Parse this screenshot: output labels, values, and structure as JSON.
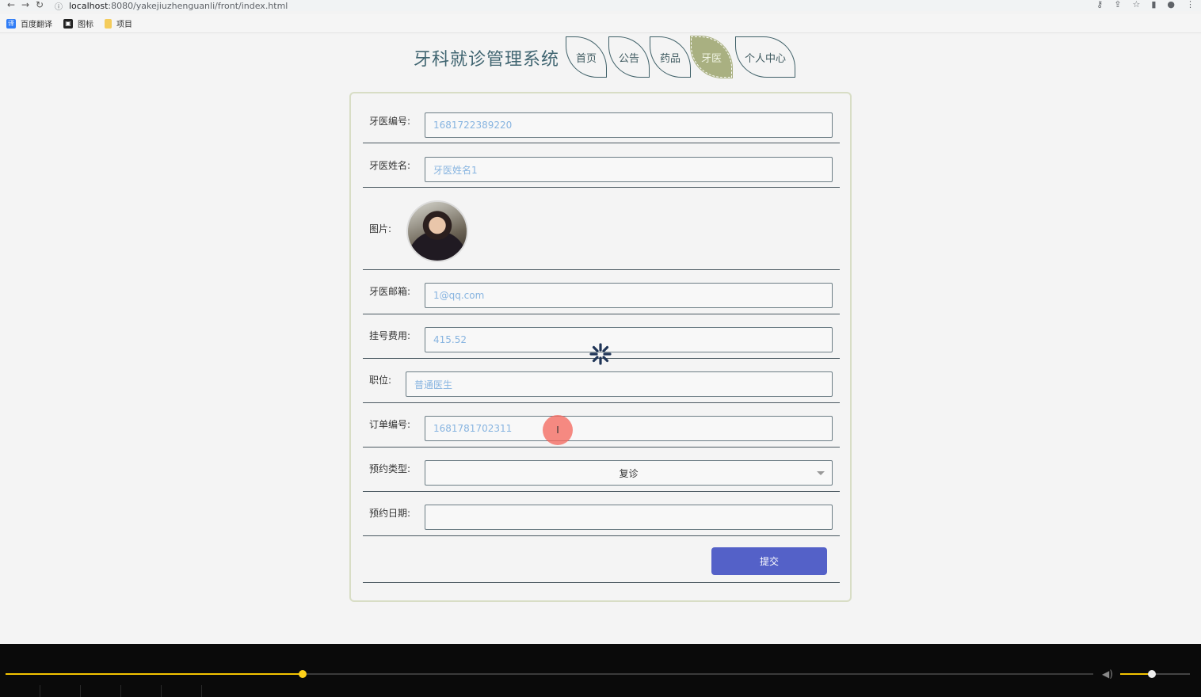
{
  "browser": {
    "url_host": "localhost",
    "url_path": ":8080/yakejiuzhenguanli/front/index.html",
    "bookmarks": [
      {
        "label": "百度翻译",
        "icon": "translate-icon"
      },
      {
        "label": "图标",
        "icon": "image-icon"
      },
      {
        "label": "项目",
        "icon": "folder-icon"
      }
    ]
  },
  "site": {
    "title": "牙科就诊管理系统",
    "nav": [
      {
        "label": "首页",
        "active": false
      },
      {
        "label": "公告",
        "active": false
      },
      {
        "label": "药品",
        "active": false
      },
      {
        "label": "牙医",
        "active": true
      },
      {
        "label": "个人中心",
        "active": false
      }
    ]
  },
  "form": {
    "dentist_no_label": "牙医编号:",
    "dentist_no_value": "1681722389220",
    "dentist_name_label": "牙医姓名:",
    "dentist_name_value": "牙医姓名1",
    "photo_label": "图片:",
    "email_label": "牙医邮箱:",
    "email_value": "1@qq.com",
    "fee_label": "挂号费用:",
    "fee_value": "415.52",
    "position_label": "职位:",
    "position_value": "普通医生",
    "order_no_label": "订单编号:",
    "order_no_value": "1681781702311",
    "type_label": "预约类型:",
    "type_value": "复诊",
    "date_label": "预约日期:",
    "date_value": "",
    "submit_label": "提交"
  },
  "player": {
    "progress": 0.273,
    "volume": 0.45
  },
  "colors": {
    "accent": "#5461c8",
    "nav_active": "#a9b081",
    "input_text": "#87b4e0"
  }
}
